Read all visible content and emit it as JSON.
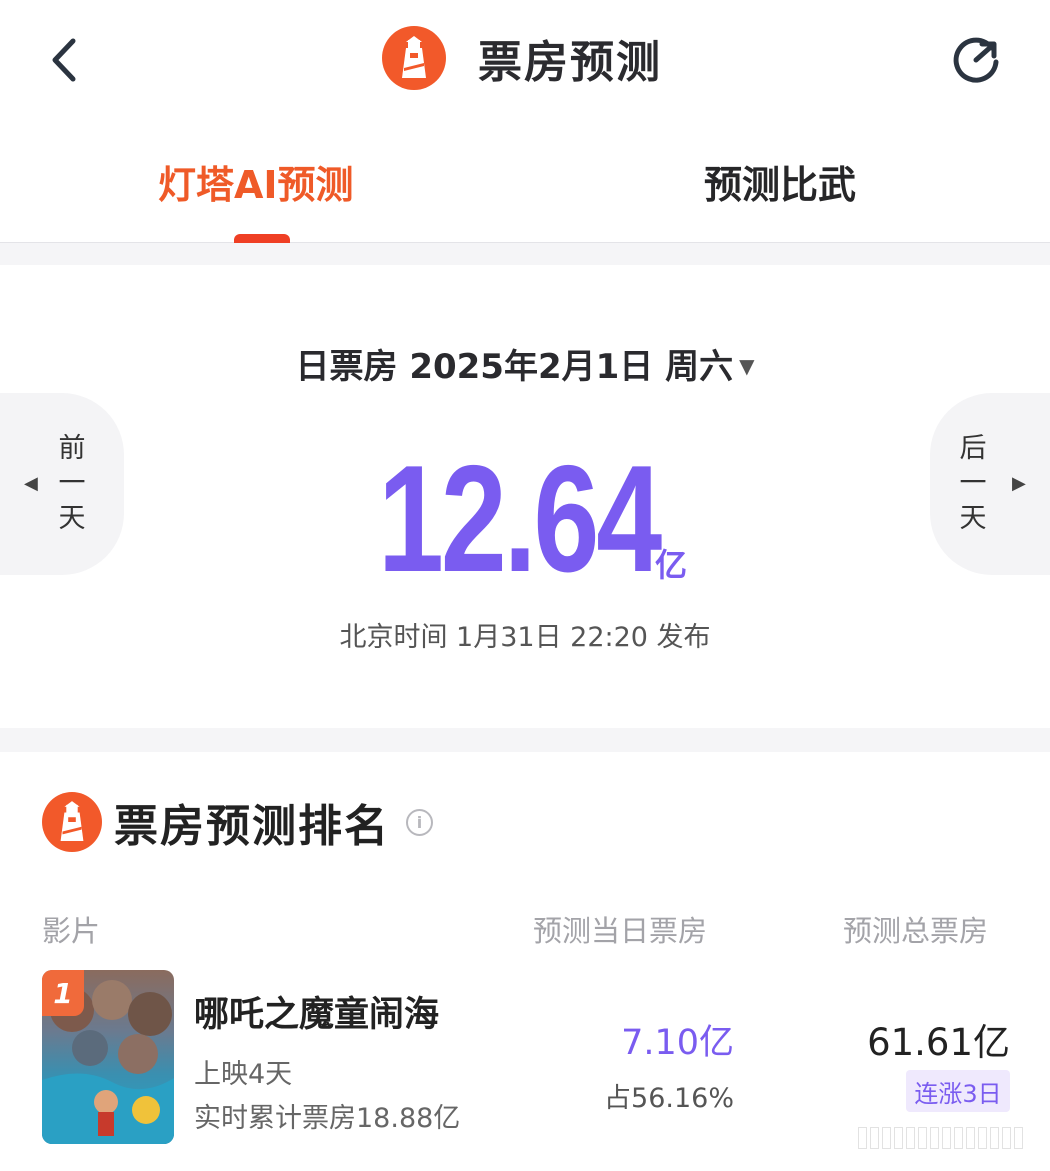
{
  "header": {
    "title": "票房预测",
    "back_icon": "chevron-left-icon",
    "refresh_icon": "refresh-icon",
    "logo_icon": "lighthouse-logo-icon"
  },
  "tabs": [
    {
      "label": "灯塔AI预测",
      "active": true
    },
    {
      "label": "预测比武",
      "active": false
    }
  ],
  "daily": {
    "date_label": "日票房 2025年2月1日 周六",
    "prev_label": "前\n一\n天",
    "next_label": "后\n一\n天",
    "value": "12.64",
    "unit": "亿",
    "publish_time": "北京时间 1月31日 22:20 发布"
  },
  "ranking": {
    "title": "票房预测排名",
    "columns": [
      "影片",
      "预测当日票房",
      "预测总票房"
    ],
    "films": [
      {
        "rank": "1",
        "name": "哪吒之魔童闹海",
        "days": "上映4天",
        "cumulative": "实时累计票房18.88亿",
        "day_forecast": "7.10亿",
        "share": "占56.16%",
        "total_forecast": "61.61亿",
        "trend": "连涨3日"
      }
    ]
  },
  "colors": {
    "accent_orange": "#ef5a28",
    "accent_purple": "#7a5cf0"
  }
}
